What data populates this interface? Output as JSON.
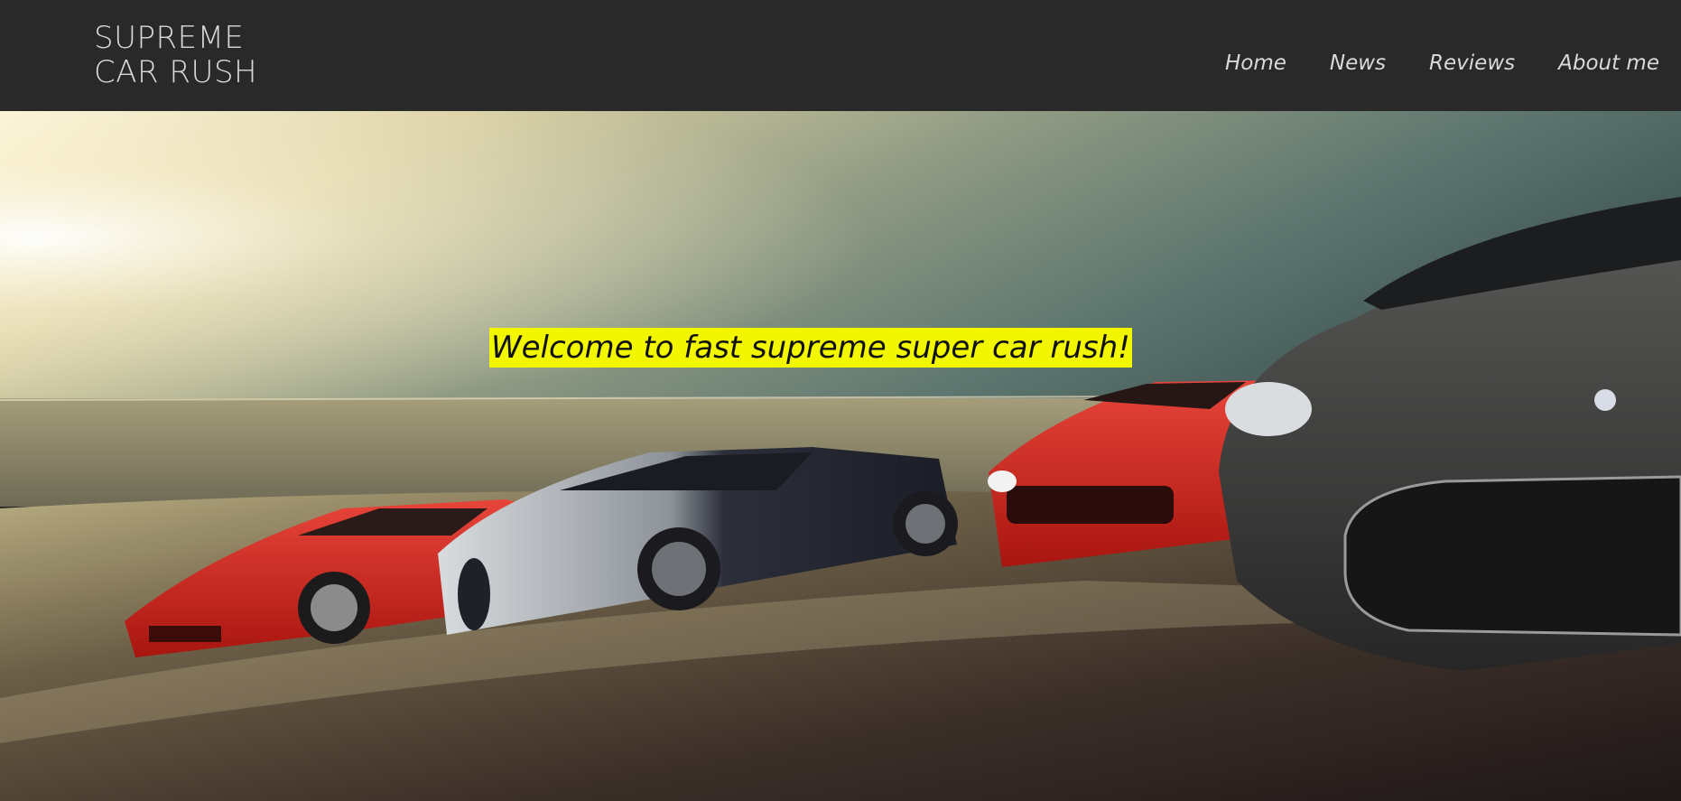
{
  "header": {
    "logo_line1": "SUPREME",
    "logo_line2": "CAR RUSH"
  },
  "nav": {
    "items": [
      {
        "label": "Home"
      },
      {
        "label": "News"
      },
      {
        "label": "Reviews"
      },
      {
        "label": "About me"
      }
    ]
  },
  "hero": {
    "headline": "Welcome to fast supreme super car rush!",
    "highlight_color": "#f2f700"
  },
  "colors": {
    "header_bg": "#292929",
    "nav_text": "#d9d9d9"
  }
}
